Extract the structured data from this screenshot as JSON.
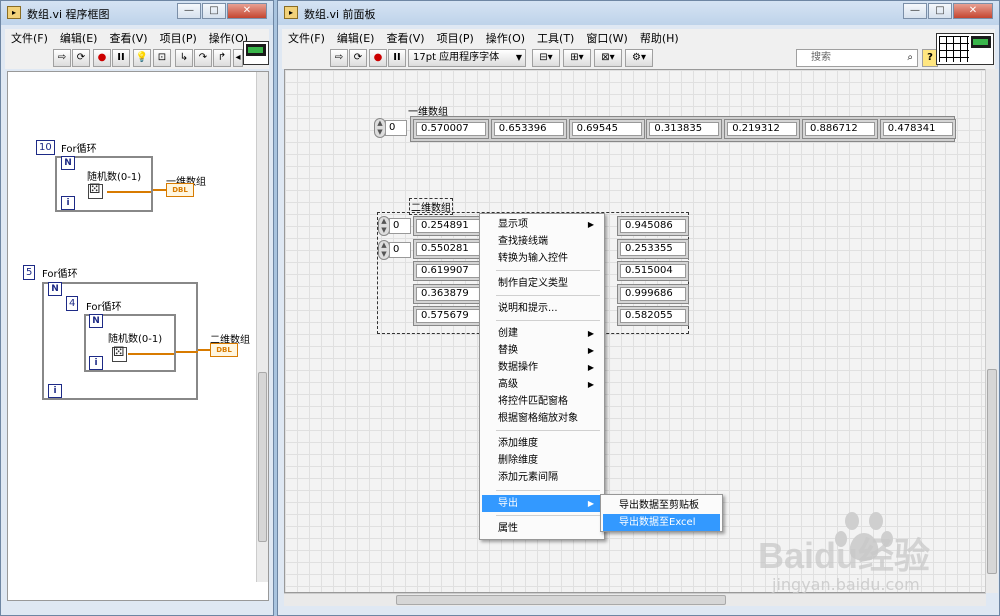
{
  "left_window": {
    "title": "数组.vi 程序框图",
    "menus": [
      "文件(F)",
      "编辑(E)",
      "查看(V)",
      "项目(P)",
      "操作(O)"
    ],
    "diagram": {
      "loop1": {
        "count": "10",
        "label": "For循环",
        "n": "N",
        "i": "i",
        "subvi_label": "随机数(0-1)",
        "indicator_label": "一维数组",
        "terminal": "DBL"
      },
      "loop_outer": {
        "count": "5",
        "label": "For循环",
        "n": "N",
        "i": "i"
      },
      "loop_inner": {
        "count": "4",
        "label": "For循环",
        "n": "N",
        "i": "i",
        "subvi_label": "随机数(0-1)",
        "indicator_label": "二维数组",
        "terminal": "DBL"
      }
    }
  },
  "right_window": {
    "title": "数组.vi 前面板",
    "menus": [
      "文件(F)",
      "编辑(E)",
      "查看(V)",
      "项目(P)",
      "操作(O)",
      "工具(T)",
      "窗口(W)",
      "帮助(H)"
    ],
    "toolbar": {
      "font_select": "17pt 应用程序字体",
      "search_placeholder": "搜索",
      "help": "?"
    },
    "array1d": {
      "label": "一维数组",
      "index": "0",
      "values": [
        "0.570007",
        "0.653396",
        "0.69545",
        "0.313835",
        "0.219312",
        "0.886712",
        "0.478341"
      ]
    },
    "array2d": {
      "label": "二维数组",
      "index_row": "0",
      "index_col": "0",
      "col1": [
        "0.254891",
        "0.550281",
        "0.619907",
        "0.363879",
        "0.575679"
      ],
      "col_last": [
        "0.945086",
        "0.253355",
        "0.515004",
        "0.999686",
        "0.582055"
      ]
    }
  },
  "context_menu": {
    "items": [
      {
        "label": "显示项",
        "sub": true
      },
      {
        "label": "查找接线端",
        "sub": false
      },
      {
        "label": "转换为输入控件",
        "sub": false
      },
      {
        "label": "制作自定义类型",
        "sub": false
      },
      {
        "label": "说明和提示...",
        "sub": false
      },
      {
        "label": "创建",
        "sub": true
      },
      {
        "label": "替换",
        "sub": true
      },
      {
        "label": "数据操作",
        "sub": true
      },
      {
        "label": "高级",
        "sub": true
      },
      {
        "label": "将控件匹配窗格",
        "sub": false
      },
      {
        "label": "根据窗格缩放对象",
        "sub": false
      },
      {
        "label": "添加维度",
        "sub": false
      },
      {
        "label": "删除维度",
        "sub": false
      },
      {
        "label": "添加元素间隔",
        "sub": false
      },
      {
        "label": "导出",
        "sub": true
      },
      {
        "label": "属性",
        "sub": false
      }
    ],
    "submenu": [
      "导出数据至剪贴板",
      "导出数据至Excel"
    ],
    "arrow": "▶"
  },
  "watermark": {
    "logo": "Baidu经验",
    "url": "jingyan.baidu.com"
  },
  "colors": {
    "highlight": "#3399ff",
    "wire": "#d87b00",
    "terminal_border": "#1d2a86"
  }
}
